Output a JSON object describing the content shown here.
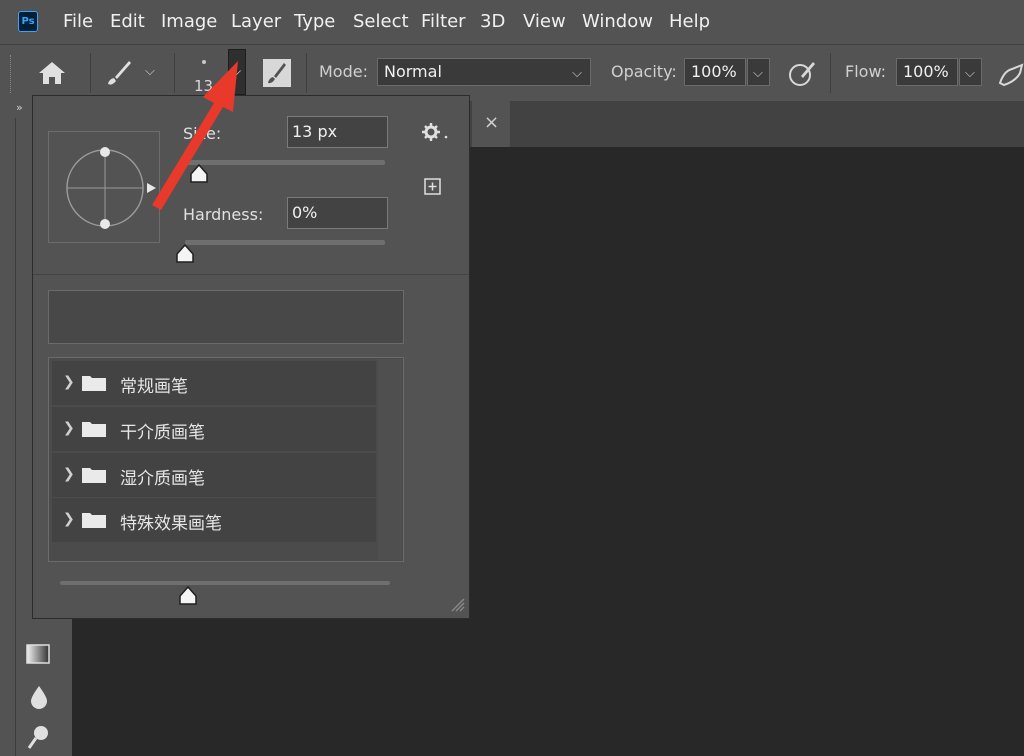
{
  "app": {
    "logo": "Ps"
  },
  "menu": {
    "items": [
      "File",
      "Edit",
      "Image",
      "Layer",
      "Type",
      "Select",
      "Filter",
      "3D",
      "View",
      "Window",
      "Help"
    ]
  },
  "options": {
    "brush_size_preview": "13",
    "mode_label": "Mode:",
    "mode_value": "Normal",
    "opacity_label": "Opacity:",
    "opacity_value": "100%",
    "flow_label": "Flow:",
    "flow_value": "100%"
  },
  "brush_panel": {
    "size_label": "Size:",
    "size_value": "13 px",
    "hardness_label": "Hardness:",
    "hardness_value": "0%",
    "size_level": 0.07,
    "hardness_level": 0.0,
    "folders": [
      {
        "label": "常规画笔"
      },
      {
        "label": "干介质画笔"
      },
      {
        "label": "湿介质画笔"
      },
      {
        "label": "特殊效果画笔"
      }
    ]
  },
  "document": {
    "tab_close": "×"
  },
  "annotation": {
    "color": "#e8392b"
  },
  "colors": {
    "chrome": "#535353",
    "canvas": "#282828",
    "menubar_text": "#f0f0f0"
  }
}
